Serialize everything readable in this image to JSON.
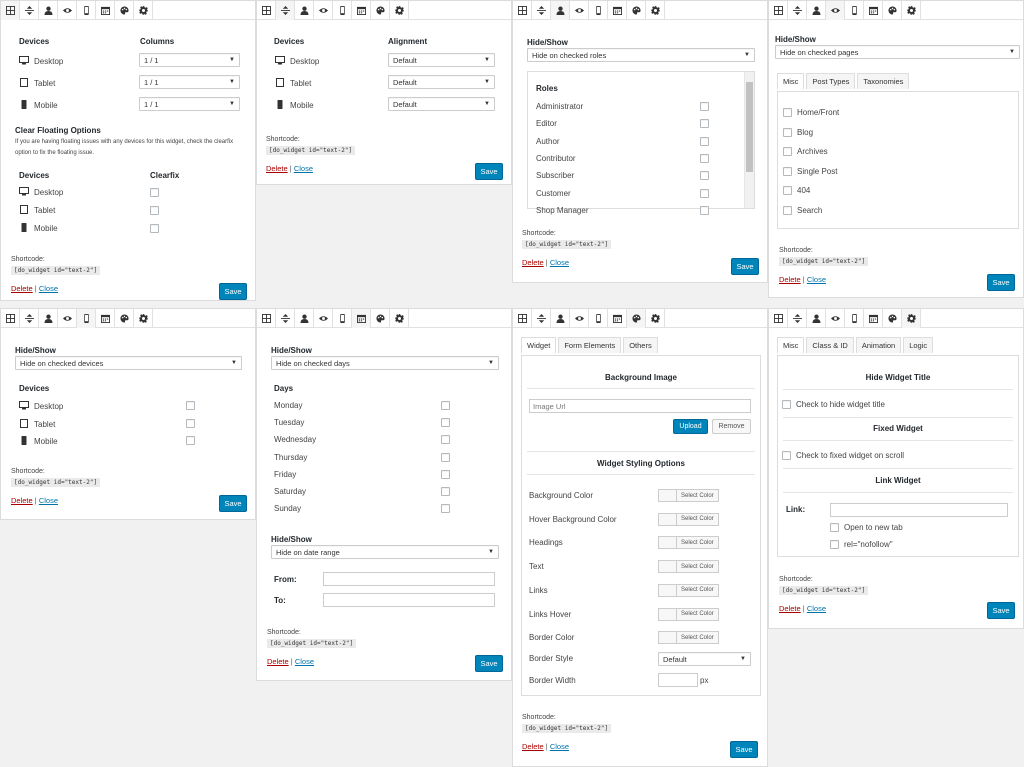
{
  "common": {
    "shortcode_label": "Shortcode:",
    "shortcode": "[do_widget id=\"text-2\"]",
    "delete": "Delete",
    "sep": "|",
    "close": "Close",
    "save": "Save"
  },
  "p1": {
    "devices": "Devices",
    "columns": "Columns",
    "rows": [
      {
        "label": "Desktop",
        "value": "1 / 1"
      },
      {
        "label": "Tablet",
        "value": "1 / 1"
      },
      {
        "label": "Mobile",
        "value": "1 / 1"
      }
    ],
    "clear_title": "Clear Floating Options",
    "clear_desc1": "If you are having floating issues with any devices for this widget, check the clearfix",
    "clear_desc2": "option to fix the floating issue.",
    "clearfix": "Clearfix"
  },
  "p2": {
    "devices": "Devices",
    "alignment": "Alignment",
    "rows": [
      {
        "label": "Desktop",
        "value": "Default"
      },
      {
        "label": "Tablet",
        "value": "Default"
      },
      {
        "label": "Mobile",
        "value": "Default"
      }
    ]
  },
  "p3": {
    "hideshow": "Hide/Show",
    "select": "Hide on checked roles",
    "roles": "Roles",
    "items": [
      "Administrator",
      "Editor",
      "Author",
      "Contributor",
      "Subscriber",
      "Customer",
      "Shop Manager"
    ]
  },
  "p4": {
    "hideshow": "Hide/Show",
    "select": "Hide on checked pages",
    "tabs": [
      "Misc",
      "Post Types",
      "Taxonomies"
    ],
    "items": [
      "Home/Front",
      "Blog",
      "Archives",
      "Single Post",
      "404",
      "Search"
    ]
  },
  "p5": {
    "hideshow": "Hide/Show",
    "select": "Hide on checked devices",
    "devices": "Devices",
    "items": [
      "Desktop",
      "Tablet",
      "Mobile"
    ]
  },
  "p6": {
    "hideshow": "Hide/Show",
    "select": "Hide on checked days",
    "days": "Days",
    "items": [
      "Monday",
      "Tuesday",
      "Wednesday",
      "Thursday",
      "Friday",
      "Saturday",
      "Sunday"
    ],
    "hideshow2": "Hide/Show",
    "select2": "Hide on date range",
    "from": "From:",
    "to": "To:"
  },
  "p7": {
    "tabs": [
      "Widget",
      "Form Elements",
      "Others"
    ],
    "bg_image": "Background Image",
    "image_placeholder": "Image Url",
    "upload": "Upload",
    "remove": "Remove",
    "styling": "Widget Styling Options",
    "select_color": "Select Color",
    "color_items": [
      "Background Color",
      "Hover Background Color",
      "Headings",
      "Text",
      "Links",
      "Links Hover",
      "Border Color"
    ],
    "border_style": "Border Style",
    "border_style_value": "Default",
    "border_width": "Border Width",
    "px": "px"
  },
  "p8": {
    "tabs": [
      "Misc",
      "Class & ID",
      "Animation",
      "Logic"
    ],
    "hide_title": "Hide Widget Title",
    "hide_title_cb": "Check to hide widget title",
    "fixed": "Fixed Widget",
    "fixed_cb": "Check to fixed widget on scroll",
    "link_widget": "Link Widget",
    "link": "Link:",
    "new_tab": "Open to new tab",
    "nofollow": "rel=\"nofollow\""
  },
  "toolbar_icons": [
    "columns-icon",
    "alignment-icon",
    "user-icon",
    "eye-icon",
    "mobile-icon",
    "calendar-icon",
    "palette-icon",
    "gear-icon"
  ],
  "colors": {
    "primary": "#0085ba",
    "delete": "#aa0000",
    "link": "#0073aa"
  }
}
